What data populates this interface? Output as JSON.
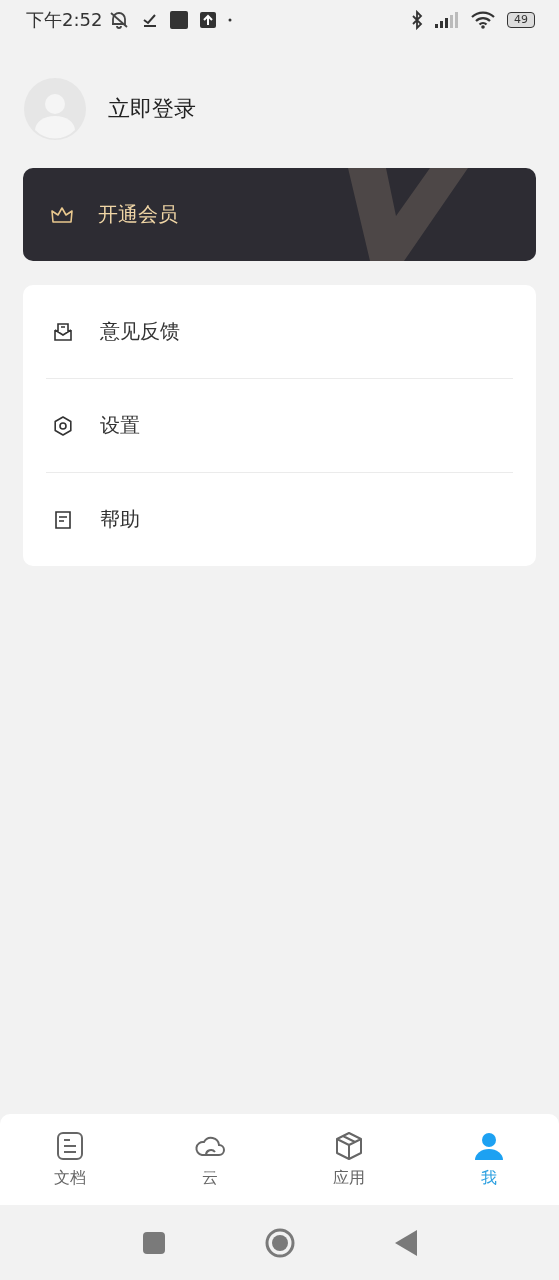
{
  "status_bar": {
    "time": "下午2:52",
    "battery": "49"
  },
  "profile": {
    "login": "立即登录"
  },
  "vip": {
    "label": "开通会员"
  },
  "menu": [
    {
      "kind": "feedback",
      "label": "意见反馈"
    },
    {
      "kind": "settings",
      "label": "设置"
    },
    {
      "kind": "help",
      "label": "帮助"
    }
  ],
  "tabs": [
    {
      "kind": "docs",
      "label": "文档",
      "selected": false
    },
    {
      "kind": "cloud",
      "label": "云",
      "selected": false
    },
    {
      "kind": "apps",
      "label": "应用",
      "selected": false
    },
    {
      "kind": "me",
      "label": "我",
      "selected": true
    }
  ]
}
